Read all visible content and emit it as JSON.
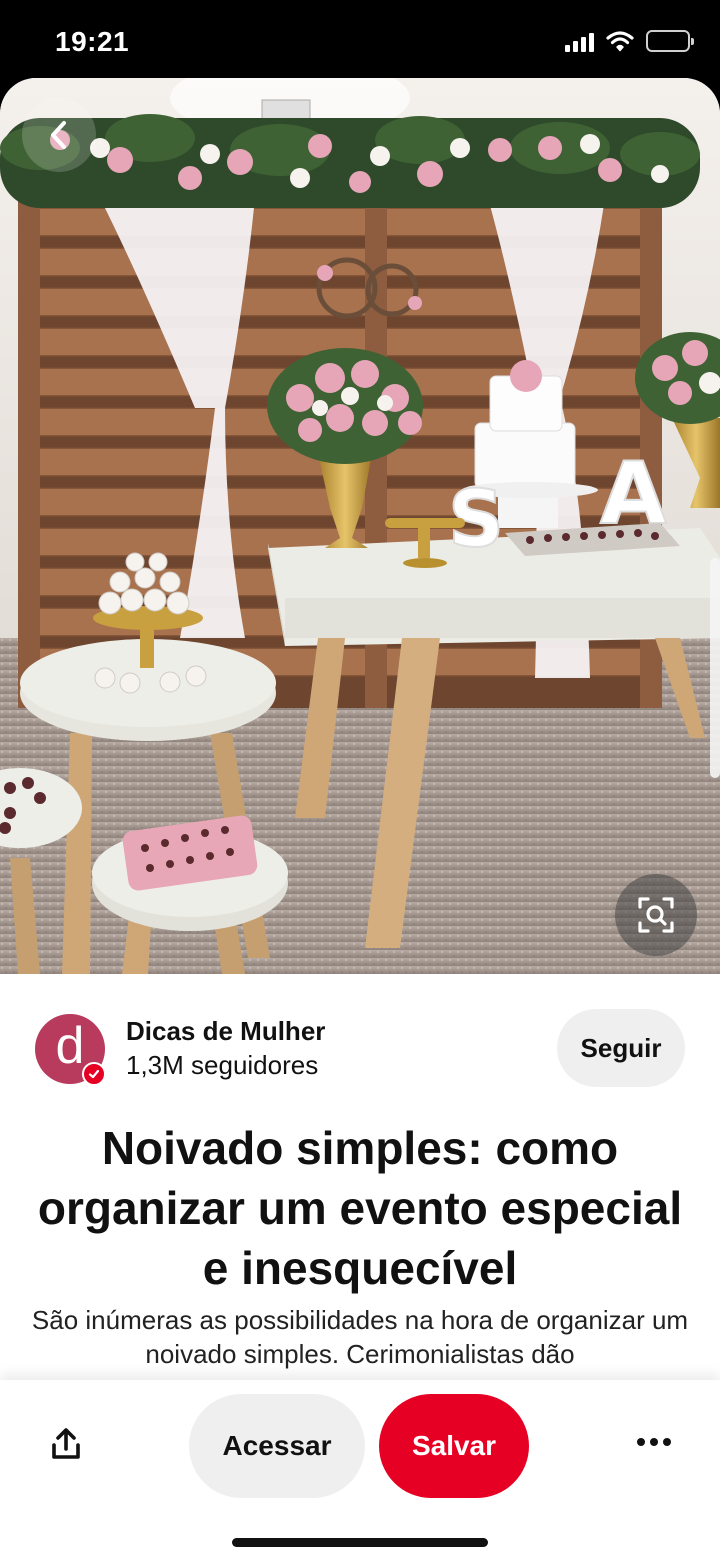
{
  "status_bar": {
    "time": "19:21"
  },
  "photo": {
    "alt": "",
    "colors": {
      "wall": "#e8e2dc",
      "pallet": "#9a6848",
      "rug": "#a89c94",
      "table_top": "#eeeee8",
      "flowers": "#e6a6b8",
      "leaves": "#2e4a2a",
      "curtain": "#f4f0f2",
      "gold": "#c9a040"
    }
  },
  "creator": {
    "avatar_letter": "d",
    "name": "Dicas de Mulher",
    "followers": "1,3M seguidores",
    "follow_label": "Seguir"
  },
  "pin": {
    "title": "Noivado simples: como organizar um evento especial e inesquecível",
    "description": "São inúmeras as possibilidades na hora de organizar um noivado simples. Cerimonialistas dão"
  },
  "actions": {
    "share_icon": "share-icon",
    "visit_label": "Acessar",
    "save_label": "Salvar",
    "more_icon": "more-icon"
  },
  "colors": {
    "brand_red": "#e60023",
    "avatar_bg": "#b83a5c",
    "button_gray": "#efefef"
  }
}
